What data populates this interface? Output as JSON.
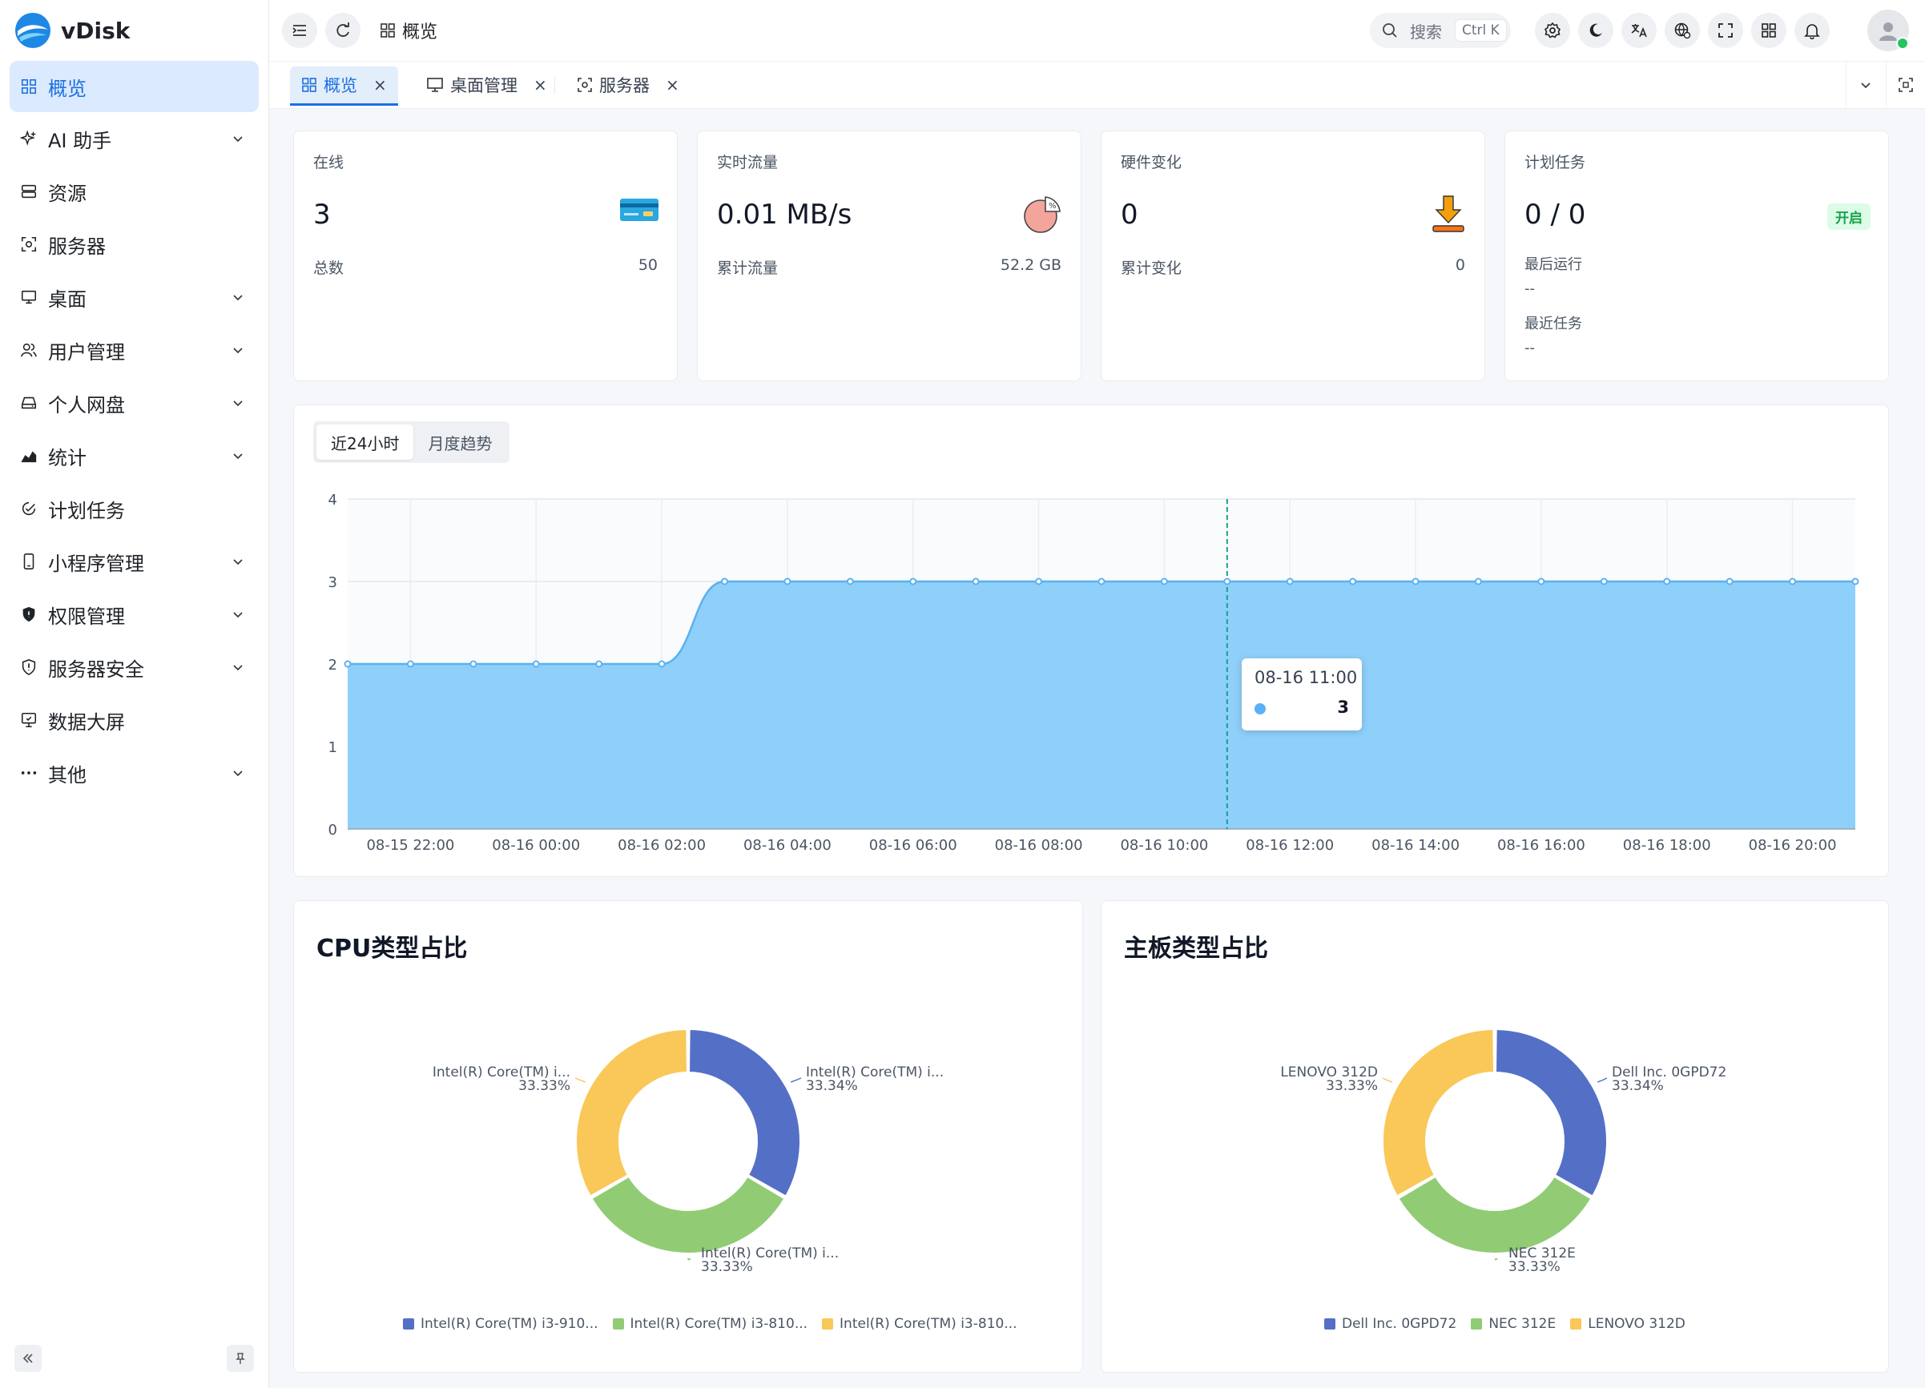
{
  "app": {
    "name": "vDisk"
  },
  "sidebar": {
    "items": [
      {
        "label": "概览",
        "icon": "dashboard-icon",
        "active": true,
        "expandable": false
      },
      {
        "label": "AI 助手",
        "icon": "sparkle-icon",
        "expandable": true
      },
      {
        "label": "资源",
        "icon": "storage-icon",
        "expandable": false
      },
      {
        "label": "服务器",
        "icon": "server-icon",
        "expandable": false
      },
      {
        "label": "桌面",
        "icon": "desktop-icon",
        "expandable": true
      },
      {
        "label": "用户管理",
        "icon": "users-icon",
        "expandable": true
      },
      {
        "label": "个人网盘",
        "icon": "drive-icon",
        "expandable": true
      },
      {
        "label": "统计",
        "icon": "chart-icon",
        "expandable": true
      },
      {
        "label": "计划任务",
        "icon": "task-check-icon",
        "expandable": false
      },
      {
        "label": "小程序管理",
        "icon": "phone-icon",
        "expandable": true
      },
      {
        "label": "权限管理",
        "icon": "shield-icon",
        "expandable": true
      },
      {
        "label": "服务器安全",
        "icon": "security-alert-icon",
        "expandable": true
      },
      {
        "label": "数据大屏",
        "icon": "monitor-icon",
        "expandable": false
      },
      {
        "label": "其他",
        "icon": "more-icon",
        "expandable": true
      }
    ]
  },
  "header": {
    "breadcrumb": "概览",
    "search_label": "搜索",
    "search_shortcut": "Ctrl K"
  },
  "tabs": [
    {
      "label": "概览",
      "active": true
    },
    {
      "label": "桌面管理",
      "active": false
    },
    {
      "label": "服务器",
      "active": false
    }
  ],
  "stats": {
    "online": {
      "title": "在线",
      "value": "3",
      "sub_label": "总数",
      "sub_value": "50"
    },
    "traffic": {
      "title": "实时流量",
      "value": "0.01 MB/s",
      "sub_label": "累计流量",
      "sub_value": "52.2 GB"
    },
    "hardware": {
      "title": "硬件变化",
      "value": "0",
      "sub_label": "累计变化",
      "sub_value": "0"
    },
    "tasks": {
      "title": "计划任务",
      "value": "0 / 0",
      "badge": "开启",
      "last_run_label": "最后运行",
      "last_run_value": "--",
      "recent_label": "最近任务",
      "recent_value": "--"
    }
  },
  "trend": {
    "range_tabs": [
      "近24小时",
      "月度趋势"
    ],
    "active_range": 0,
    "tooltip": {
      "time": "08-16 11:00",
      "value": "3"
    }
  },
  "chart_data": [
    {
      "type": "area",
      "x": [
        "08-15 21:00",
        "08-15 22:00",
        "08-15 23:00",
        "08-16 00:00",
        "08-16 01:00",
        "08-16 02:00",
        "08-16 03:00",
        "08-16 04:00",
        "08-16 05:00",
        "08-16 06:00",
        "08-16 07:00",
        "08-16 08:00",
        "08-16 09:00",
        "08-16 10:00",
        "08-16 11:00",
        "08-16 12:00",
        "08-16 13:00",
        "08-16 14:00",
        "08-16 15:00",
        "08-16 16:00",
        "08-16 17:00",
        "08-16 18:00",
        "08-16 19:00",
        "08-16 20:00",
        "08-16 21:00"
      ],
      "y": [
        2,
        2,
        2,
        2,
        2,
        2,
        3,
        3,
        3,
        3,
        3,
        3,
        3,
        3,
        3,
        3,
        3,
        3,
        3,
        3,
        3,
        3,
        3,
        3,
        3
      ],
      "x_tick_labels": [
        "08-15 22:00",
        "08-16 00:00",
        "08-16 02:00",
        "08-16 04:00",
        "08-16 06:00",
        "08-16 08:00",
        "08-16 10:00",
        "08-16 12:00",
        "08-16 14:00",
        "08-16 16:00",
        "08-16 18:00",
        "08-16 20:00"
      ],
      "y_ticks": [
        0,
        1,
        2,
        3,
        4
      ],
      "ylim": [
        0,
        4
      ],
      "color": "#8fd0fb",
      "line_color": "#5ab1f0",
      "grid": true
    },
    {
      "type": "pie",
      "title": "CPU类型占比",
      "slices": [
        {
          "label": "Intel(R) Core(TM) i3-910...",
          "short": "Intel(R) Core(TM) i...",
          "value": 33.34,
          "pct": "33.34%",
          "color": "#5470c6"
        },
        {
          "label": "Intel(R) Core(TM) i3-810...",
          "short": "Intel(R) Core(TM) i...",
          "value": 33.33,
          "pct": "33.33%",
          "color": "#91cc75"
        },
        {
          "label": "Intel(R) Core(TM) i3-810...",
          "short": "Intel(R) Core(TM) i...",
          "value": 33.33,
          "pct": "33.33%",
          "color": "#fac858"
        }
      ]
    },
    {
      "type": "pie",
      "title": "主板类型占比",
      "slices": [
        {
          "label": "Dell Inc. 0GPD72",
          "short": "Dell Inc. 0GPD72",
          "value": 33.34,
          "pct": "33.34%",
          "color": "#5470c6"
        },
        {
          "label": "NEC 312E",
          "short": "NEC 312E",
          "value": 33.33,
          "pct": "33.33%",
          "color": "#91cc75"
        },
        {
          "label": "LENOVO 312D",
          "short": "LENOVO 312D",
          "value": 33.33,
          "pct": "33.33%",
          "color": "#fac858"
        }
      ]
    }
  ]
}
